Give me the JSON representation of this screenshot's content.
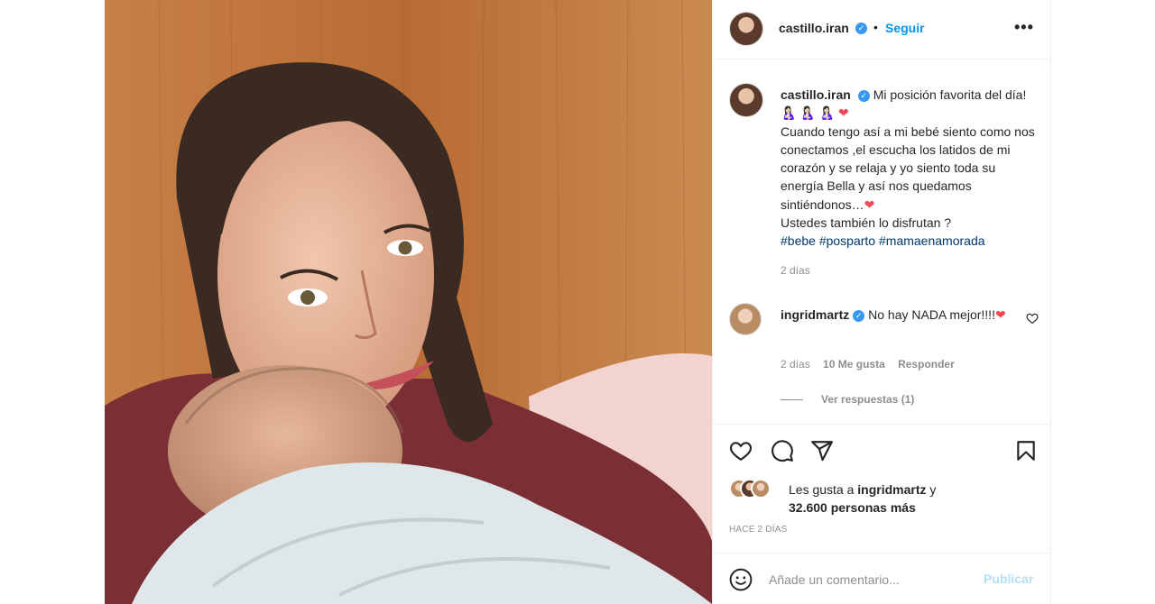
{
  "post": {
    "photo_alt": "",
    "author": {
      "username": "castillo.iran",
      "verified_mark": "✓",
      "separator": "•",
      "follow_label": "Seguir",
      "more_label": "•••"
    },
    "caption": {
      "username": "castillo.iran",
      "line1": "Mi posición favorita del día! 🤱🏻 🤱🏻 🤱🏻",
      "heart1": "❤",
      "body": "Cuando tengo así a mi bebé siento como nos conectamos ,el escucha los latidos de mi corazón y se relaja y yo siento toda su energía Bella y así nos quedamos sintiéndonos…",
      "heart2": "❤",
      "question": "Ustedes también lo disfrutan ?",
      "hashtags": [
        "#bebe",
        "#posparto",
        "#mamaenamorada"
      ],
      "time": "2 días"
    },
    "comment": {
      "username": "ingridmartz",
      "text": "No hay NADA mejor!!!!",
      "heart": "❤",
      "time": "2 días",
      "likes": "10 Me gusta",
      "reply_label": "Responder",
      "view_replies_label": "Ver respuestas (1)"
    },
    "likes": {
      "prefix": "Les gusta a",
      "user": "ingridmartz",
      "connector": "y",
      "others": "32.600 personas más"
    },
    "timestamp": "HACE 2 DÍAS",
    "add_comment": {
      "placeholder": "Añade un comentario...",
      "publish_label": "Publicar"
    },
    "icons": {
      "like": "heart-outline-icon",
      "comment": "comment-bubble-icon",
      "share": "paper-plane-icon",
      "save": "bookmark-icon",
      "emoji": "smiley-icon"
    },
    "colors": {
      "link_blue": "#0095f6",
      "publish_disabled": "#b2dffc",
      "hashtag": "#00376b",
      "heart": "#ed4956",
      "verified": "#3897f0"
    }
  }
}
